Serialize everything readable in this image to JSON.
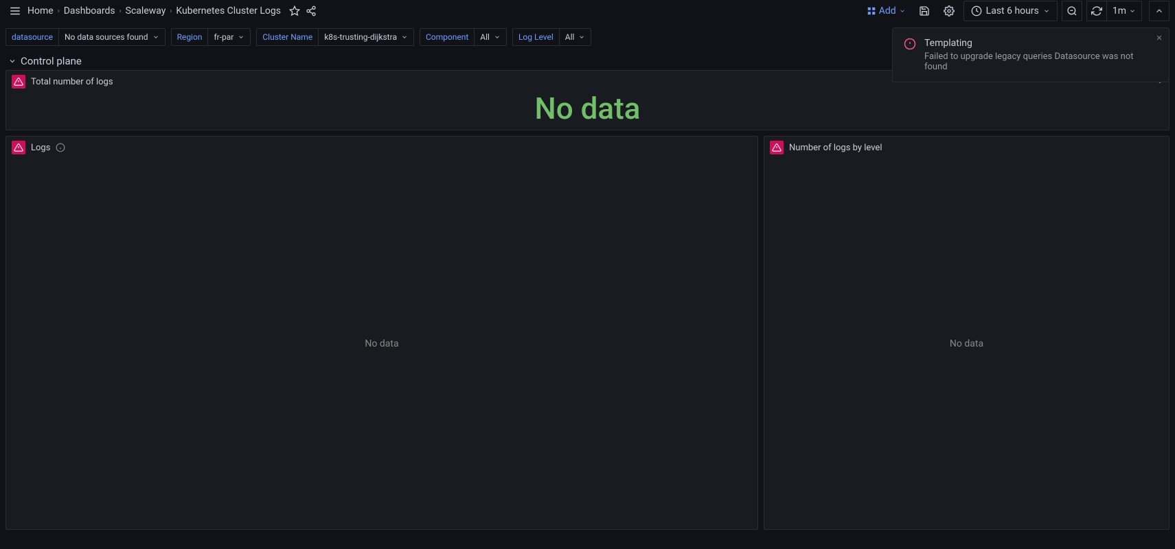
{
  "breadcrumb": {
    "home": "Home",
    "dashboards": "Dashboards",
    "scaleway": "Scaleway",
    "current": "Kubernetes Cluster Logs"
  },
  "topbar": {
    "add": "Add",
    "time_label": "Last 6 hours",
    "refresh_interval": "1m"
  },
  "vars": {
    "datasource_label": "datasource",
    "datasource_value": "No data sources found",
    "region_label": "Region",
    "region_value": "fr-par",
    "cluster_label": "Cluster Name",
    "cluster_value": "k8s-trusting-dijkstra",
    "component_label": "Component",
    "component_value": "All",
    "loglevel_label": "Log Level",
    "loglevel_value": "All"
  },
  "section": {
    "title": "Control plane"
  },
  "panels": {
    "total_logs_title": "Total number of logs",
    "total_logs_value": "No data",
    "logs_title": "Logs",
    "logs_empty": "No data",
    "by_level_title": "Number of logs by level",
    "by_level_empty": "No data"
  },
  "toast": {
    "title": "Templating",
    "message": "Failed to upgrade legacy queries Datasource was not found"
  }
}
